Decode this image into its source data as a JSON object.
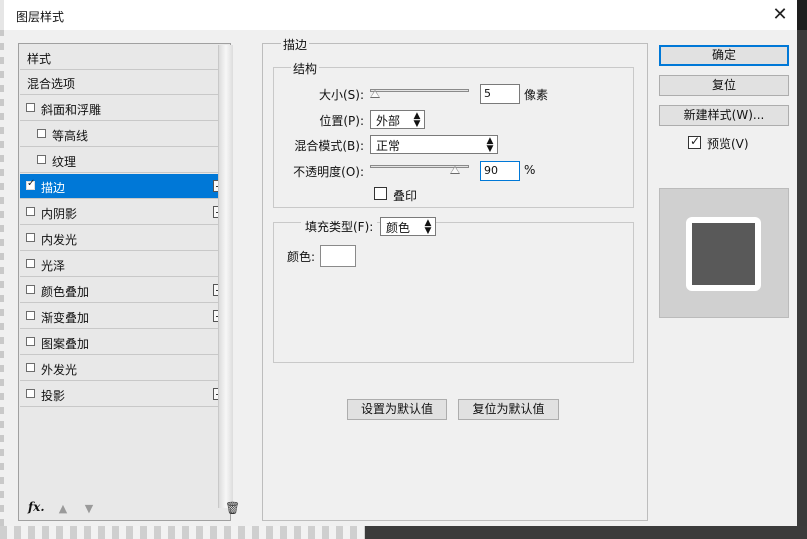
{
  "window": {
    "title": "图层样式",
    "close_label": "✕"
  },
  "styles_list": {
    "header": "样式",
    "items": [
      {
        "label": "混合选项",
        "has_checkbox": false
      },
      {
        "label": "斜面和浮雕",
        "has_checkbox": true,
        "checked": false
      },
      {
        "label": "等高线",
        "has_checkbox": true,
        "checked": false,
        "indent": true
      },
      {
        "label": "纹理",
        "has_checkbox": true,
        "checked": false,
        "indent": true
      },
      {
        "label": "描边",
        "has_checkbox": true,
        "checked": true,
        "selected": true,
        "plus": true
      },
      {
        "label": "内阴影",
        "has_checkbox": true,
        "checked": false,
        "plus": true
      },
      {
        "label": "内发光",
        "has_checkbox": true,
        "checked": false
      },
      {
        "label": "光泽",
        "has_checkbox": true,
        "checked": false
      },
      {
        "label": "颜色叠加",
        "has_checkbox": true,
        "checked": false,
        "plus": true
      },
      {
        "label": "渐变叠加",
        "has_checkbox": true,
        "checked": false,
        "plus": true
      },
      {
        "label": "图案叠加",
        "has_checkbox": true,
        "checked": false
      },
      {
        "label": "外发光",
        "has_checkbox": true,
        "checked": false
      },
      {
        "label": "投影",
        "has_checkbox": true,
        "checked": false,
        "plus": true
      }
    ],
    "footer": {
      "fx_label": "fx",
      "fx_menu_indicator": ".",
      "up_icon": "▲",
      "down_icon": "▼",
      "trash_icon": "🗑"
    }
  },
  "stroke": {
    "section_title": "描边",
    "structure": {
      "title": "结构",
      "size_label": "大小(S):",
      "size_value": "5",
      "size_unit": "像素",
      "size_slider_fraction": 0.0,
      "position_label": "位置(P):",
      "position_value": "外部",
      "blend_label": "混合模式(B):",
      "blend_value": "正常",
      "opacity_label": "不透明度(O):",
      "opacity_value": "90",
      "opacity_unit": "%",
      "opacity_slider_fraction": 0.9,
      "overprint_label": "叠印",
      "overprint_checked": false
    },
    "fill": {
      "type_label": "填充类型(F):",
      "type_value": "颜色",
      "color_label": "颜色:",
      "color_value": "#ffffff"
    },
    "set_default_label": "设置为默认值",
    "reset_default_label": "复位为默认值"
  },
  "actions": {
    "ok_label": "确定",
    "reset_label": "复位",
    "new_style_label": "新建样式(W)...",
    "preview_label": "预览(V)",
    "preview_checked": true
  },
  "preview_swatch": {
    "stroke_color": "#ffffff",
    "fill_color": "#595959"
  }
}
